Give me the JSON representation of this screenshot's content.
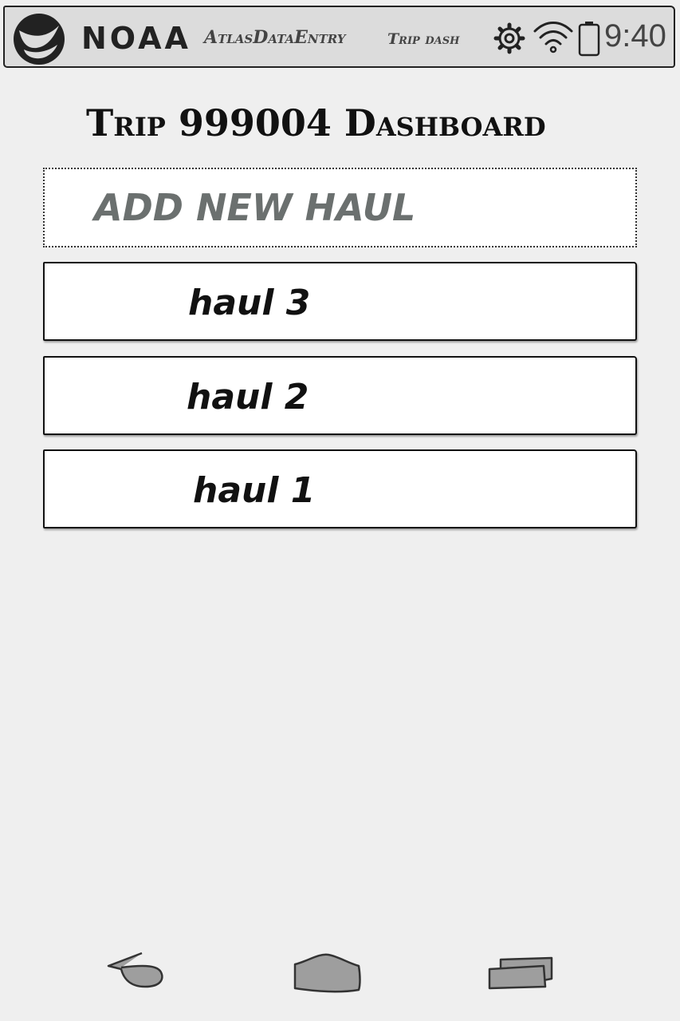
{
  "status_bar": {
    "brand_logo": "noaa-logo",
    "brand_text": "NOAA",
    "app_name": "AtlasDataEntry",
    "screen_name": "Trip dash",
    "icons": [
      "settings-icon",
      "wifi-icon",
      "battery-icon"
    ],
    "clock": "9:40"
  },
  "main": {
    "title": "Trip 999004 Dashboard",
    "add_button_label": "ADD NEW HAUL",
    "hauls": [
      {
        "label": "haul 3"
      },
      {
        "label": "haul 2"
      },
      {
        "label": "haul 1"
      }
    ]
  },
  "nav_bar": {
    "buttons": [
      "back",
      "home",
      "recents"
    ]
  },
  "colors": {
    "background": "#efefef",
    "status_bar": "#dcdcdc",
    "add_button_text": "#6b706f",
    "nav_button_fill": "#9e9e9e"
  }
}
